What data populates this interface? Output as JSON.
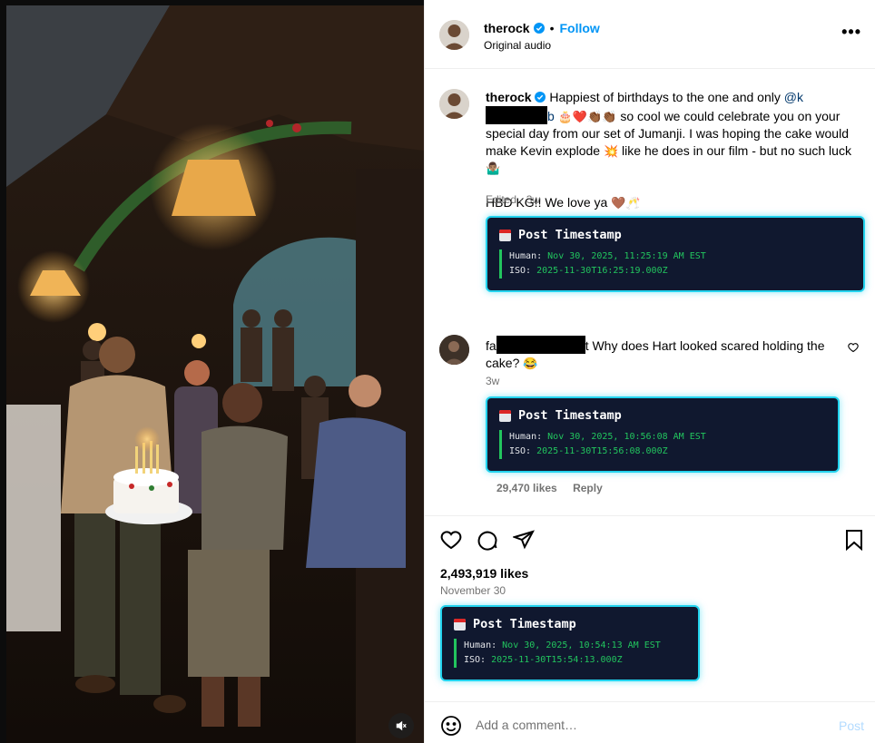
{
  "header": {
    "username": "therock",
    "follow_label": "Follow",
    "separator": "•",
    "audio": "Original audio",
    "more": "•••"
  },
  "caption": {
    "username": "therock",
    "text_1": "Happiest of birthdays to the one and only",
    "mention_start": "@k",
    "mention_end": "b",
    "emojis_1": "🎂❤️👏🏾👏🏾",
    "text_2": "so cool we could celebrate you on your special day from our set of Jumanji. I was hoping the cake would make Kevin explode",
    "emoji_boom": "💥",
    "text_3": "like he does in our film - but no such luck",
    "emoji_shrug": "🤷🏽‍♂️",
    "text_4": "HBD KG!! We love ya",
    "emojis_2": "🤎🥂",
    "meta": "Edited · 3w"
  },
  "timestamps": [
    {
      "title": "Post Timestamp",
      "human_label": "Human:",
      "human": "Nov 30, 2025, 11:25:19 AM EST",
      "iso_label": "ISO:",
      "iso": "2025-11-30T16:25:19.000Z"
    },
    {
      "title": "Post Timestamp",
      "human_label": "Human:",
      "human": "Nov 30, 2025, 10:56:08 AM EST",
      "iso_label": "ISO:",
      "iso": "2025-11-30T15:56:08.000Z"
    },
    {
      "title": "Post Timestamp",
      "human_label": "Human:",
      "human": "Nov 30, 2025, 10:54:13 AM EST",
      "iso_label": "ISO:",
      "iso": "2025-11-30T15:54:13.000Z"
    }
  ],
  "comment": {
    "user_start": "fa",
    "user_end": "t",
    "text": "Why does Hart looked scared holding the cake?",
    "emoji": "😂",
    "meta": "3w",
    "likes": "29,470 likes",
    "reply": "Reply"
  },
  "post": {
    "likes": "2,493,919 likes",
    "date": "November 30"
  },
  "comment_bar": {
    "placeholder": "Add a comment…",
    "post_label": "Post"
  },
  "colors": {
    "accent": "#0095f6",
    "timestamp_bg": "#10182f",
    "timestamp_border": "#22d3ee",
    "timestamp_value": "#22c55e"
  },
  "icons": [
    "verified-badge-icon",
    "more-icon",
    "heart-icon",
    "comment-icon",
    "share-icon",
    "bookmark-icon",
    "emoji-icon",
    "mute-icon",
    "calendar-icon"
  ]
}
